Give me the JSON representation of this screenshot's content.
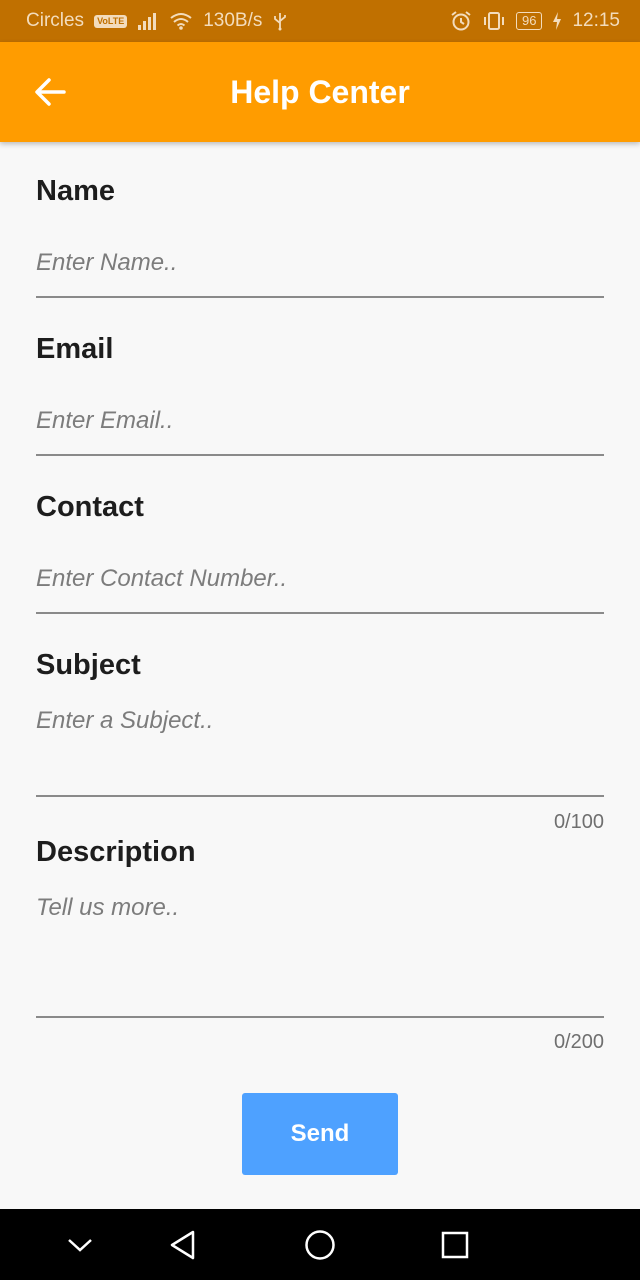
{
  "status_bar": {
    "carrier": "Circles",
    "volte": "VoLTE",
    "speed": "130B/s",
    "battery": "96",
    "time": "12:15"
  },
  "app_bar": {
    "title": "Help Center",
    "back_icon": "arrow-left-icon",
    "color": "#ff9c00"
  },
  "form": {
    "name": {
      "label": "Name",
      "placeholder": "Enter Name..",
      "value": ""
    },
    "email": {
      "label": "Email",
      "placeholder": "Enter Email..",
      "value": ""
    },
    "contact": {
      "label": "Contact",
      "placeholder": "Enter Contact Number..",
      "value": ""
    },
    "subject": {
      "label": "Subject",
      "placeholder": "Enter a Subject..",
      "value": "",
      "counter": "0/100"
    },
    "description": {
      "label": "Description",
      "placeholder": "Tell us more..",
      "value": "",
      "counter": "0/200"
    }
  },
  "send_button": {
    "label": "Send",
    "color": "#4ea1ff"
  },
  "nav_bar": {
    "icons": [
      "chevron-down-icon",
      "back-triangle-icon",
      "home-circle-icon",
      "recents-square-icon"
    ]
  }
}
